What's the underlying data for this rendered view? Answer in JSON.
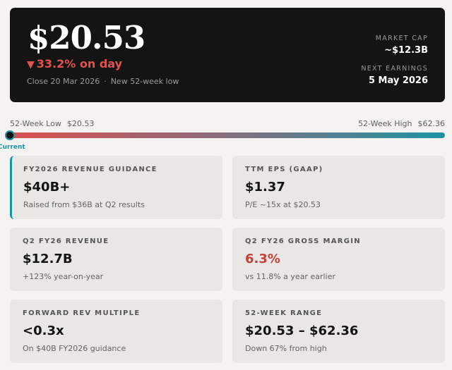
{
  "hero": {
    "price": "$20.53",
    "change_arrow": "▼",
    "change": "33.2% on day",
    "close_date": "Close 20 Mar 2026",
    "separator": "·",
    "close_note": "New 52-week low",
    "market_cap_label": "MARKET CAP",
    "market_cap_value": "~$12.3B",
    "next_earnings_label": "NEXT EARNINGS",
    "next_earnings_value": "5 May 2026",
    "colors": {
      "background": "#141414",
      "negative": "#e2524f"
    }
  },
  "range": {
    "low_label": "52-Week Low",
    "low_value": "$20.53",
    "high_label": "52-Week High",
    "high_value": "$62.36",
    "current_label": "Current",
    "current_position": 0.0,
    "colors": {
      "start": "#d9504f",
      "end": "#1c93a3"
    }
  },
  "cards": [
    {
      "label": "FY2026 REVENUE GUIDANCE",
      "value": "$40B+",
      "sub": "Raised from $36B at Q2 results",
      "highlighted": true
    },
    {
      "label": "TTM EPS (GAAP)",
      "value": "$1.37",
      "sub": "P/E ~15x at $20.53"
    },
    {
      "label": "Q2 FY26 REVENUE",
      "value": "$12.7B",
      "sub": "+123% year-on-year"
    },
    {
      "label": "Q2 FY26 GROSS MARGIN",
      "value": "6.3%",
      "sub": "vs 11.8% a year earlier",
      "value_color": "#c2413b"
    },
    {
      "label": "FORWARD REV MULTIPLE",
      "value": "<0.3x",
      "sub": "On $40B FY2026 guidance"
    },
    {
      "label": "52-WEEK RANGE",
      "value": "$20.53 – $62.36",
      "sub": "Down 67% from high"
    }
  ]
}
